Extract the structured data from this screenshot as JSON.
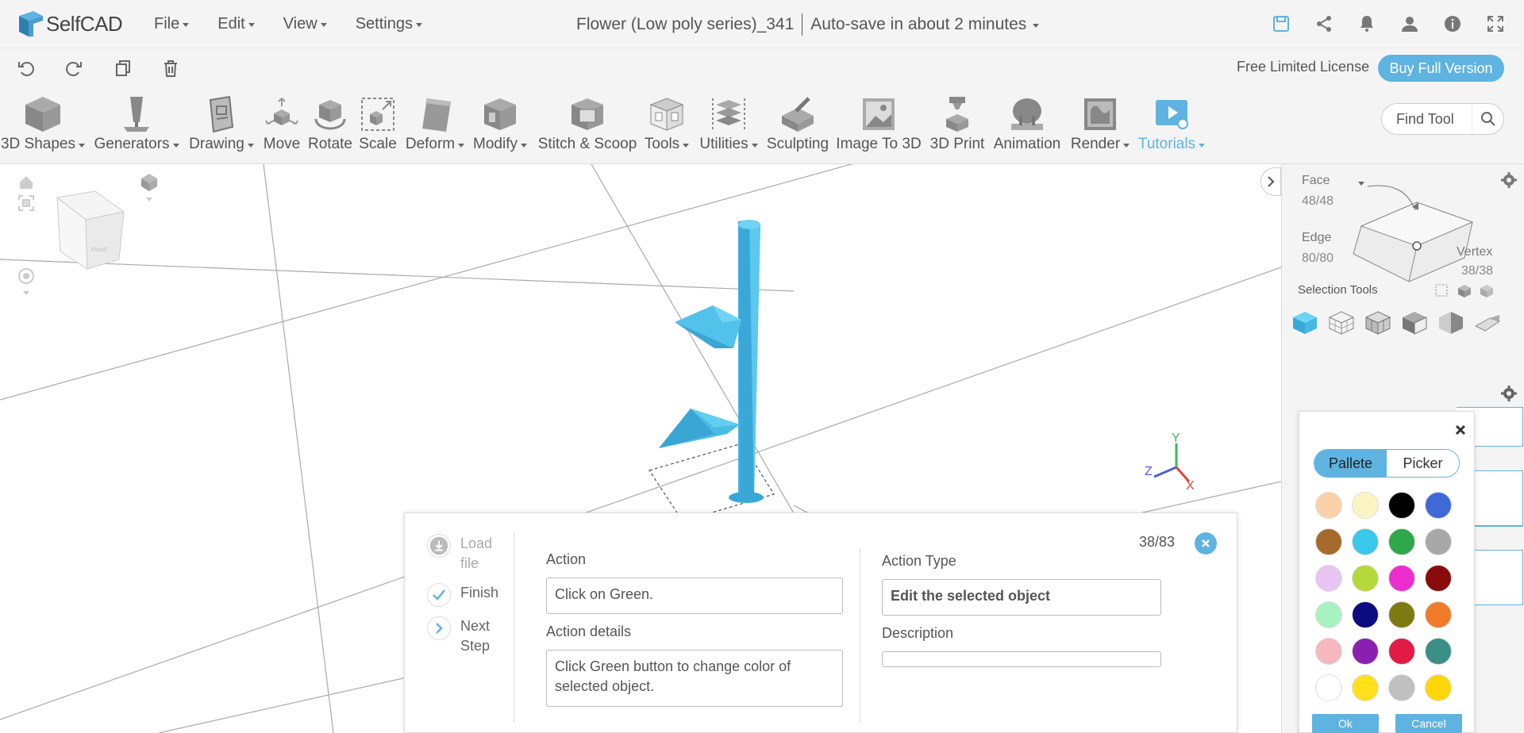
{
  "app": {
    "name": "SelfCAD",
    "document_title": "Flower (Low poly series)_341",
    "autosave": "Auto-save in about 2 minutes",
    "brand_color": "#5fb3e0"
  },
  "menu": {
    "items": [
      "File",
      "Edit",
      "View",
      "Settings"
    ]
  },
  "top_icons": [
    "save-icon",
    "share-icon",
    "bell-icon",
    "user-icon",
    "info-icon",
    "fullscreen-icon"
  ],
  "subbar": {
    "icons": [
      "undo-icon",
      "redo-icon",
      "copy-icon",
      "trash-icon"
    ],
    "license": "Free Limited License",
    "buy_label": "Buy Full Version"
  },
  "ribbon": {
    "tools": [
      {
        "label": "3D Shapes",
        "dropdown": true
      },
      {
        "label": "Generators",
        "dropdown": true
      },
      {
        "label": "Drawing",
        "dropdown": true
      },
      {
        "label": "Move",
        "dropdown": false
      },
      {
        "label": "Rotate",
        "dropdown": false
      },
      {
        "label": "Scale",
        "dropdown": false
      },
      {
        "label": "Deform",
        "dropdown": true
      },
      {
        "label": "Modify",
        "dropdown": true
      },
      {
        "label": "Stitch & Scoop",
        "dropdown": false
      },
      {
        "label": "Tools",
        "dropdown": true
      },
      {
        "label": "Utilities",
        "dropdown": true
      },
      {
        "label": "Sculpting",
        "dropdown": false
      },
      {
        "label": "Image To 3D",
        "dropdown": false
      },
      {
        "label": "3D Print",
        "dropdown": false
      },
      {
        "label": "Animation",
        "dropdown": false
      },
      {
        "label": "Render",
        "dropdown": true
      },
      {
        "label": "Tutorials",
        "dropdown": true
      }
    ],
    "find_placeholder": "Find Tool"
  },
  "viewport": {
    "axes": {
      "x": "X",
      "y": "Y",
      "z": "Z"
    },
    "cube_label": "FRONT"
  },
  "right_panel": {
    "face_label": "Face",
    "face_count": "48/48",
    "edge_label": "Edge",
    "edge_count": "80/80",
    "vertex_label": "Vertex",
    "vertex_count": "38/38",
    "selection_tools_label": "Selection Tools"
  },
  "color_popup": {
    "tab_palette": "Pallete",
    "tab_picker": "Picker",
    "ok": "Ok",
    "cancel": "Cancel",
    "swatches": [
      "#fbd2a8",
      "#fcf4c2",
      "#000000",
      "#4069d8",
      "#a66a2c",
      "#3ac7ec",
      "#2ea84a",
      "#a8a8a8",
      "#e7c4f2",
      "#b5d83a",
      "#ec2ecf",
      "#8a0b0b",
      "#a8f2c2",
      "#0c0c80",
      "#7c7a10",
      "#f07c2a",
      "#f6b8be",
      "#8a1fb0",
      "#e11b46",
      "#3b8f86",
      "#ffffff",
      "#ffe01a",
      "#c0c0c0",
      "#ffd60a"
    ]
  },
  "tutorial": {
    "steps": [
      {
        "label": "Load file",
        "state": "disabled"
      },
      {
        "label": "Finish",
        "state": "done"
      },
      {
        "label": "Next Step",
        "state": "next"
      }
    ],
    "action_label": "Action",
    "action_value": "Click on Green.",
    "action_details_label": "Action details",
    "action_details_value": "Click Green button to change color of selected object.",
    "action_type_label": "Action Type",
    "action_type_value": "Edit the selected object",
    "description_label": "Description",
    "description_value": "",
    "counter": "38/83"
  }
}
